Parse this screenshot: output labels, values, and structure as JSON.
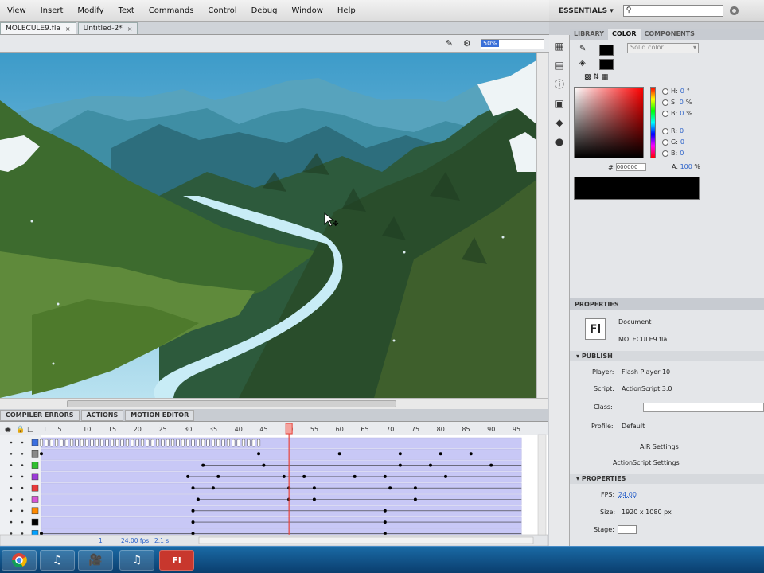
{
  "menu": [
    "View",
    "Insert",
    "Modify",
    "Text",
    "Commands",
    "Control",
    "Debug",
    "Window",
    "Help"
  ],
  "workspace": {
    "label": "ESSENTIALS",
    "search_icon": "search-icon"
  },
  "doc_tabs": [
    {
      "label": "MOLECULE9.fla",
      "close": "×"
    },
    {
      "label": "Untitled-2*",
      "close": "×"
    }
  ],
  "zoom": "50%",
  "timeline_tabs": [
    "COMPILER ERRORS",
    "ACTIONS",
    "MOTION EDITOR"
  ],
  "timeline": {
    "frame_numbers": [
      "1",
      "5",
      "10",
      "15",
      "20",
      "25",
      "30",
      "35",
      "40",
      "45",
      "50",
      "55",
      "60",
      "65",
      "70",
      "75",
      "80",
      "85",
      "90",
      "95"
    ],
    "playhead_frame": 50,
    "footer_fps": "24.00 fps",
    "footer_time": "2.1 s",
    "footer_frame": "1",
    "layer_colors": [
      "#3b6fe0",
      "#888888",
      "#2fbf2f",
      "#9b3ad8",
      "#e83a3a",
      "#d655d6",
      "#ff8a00",
      "#000000",
      "#00a0ff"
    ]
  },
  "color_panel": {
    "tabs": [
      "LIBRARY",
      "COLOR",
      "COMPONENTS"
    ],
    "active_tab": "COLOR",
    "type": "Solid color",
    "h": "0",
    "h_unit": "°",
    "s": "0",
    "s_unit": "%",
    "b": "0",
    "b_unit": "%",
    "r": "0",
    "g": "0",
    "bl": "0",
    "hex": "000000",
    "alpha": "100",
    "labels": {
      "h": "H:",
      "s": "S:",
      "b": "B:",
      "r": "R:",
      "g": "G:",
      "bl": "B:",
      "a": "A:",
      "hash": "#",
      "pct": "%"
    }
  },
  "properties": {
    "title": "PROPERTIES",
    "icon": "Fl",
    "doc_type": "Document",
    "doc_name": "MOLECULE9.fla",
    "publish_header": "PUBLISH",
    "player_label": "Player:",
    "player": "Flash Player 10",
    "script_label": "Script:",
    "script": "ActionScript 3.0",
    "class_label": "Class:",
    "profile_label": "Profile:",
    "profile": "Default",
    "air_settings": "AIR Settings",
    "as_settings": "ActionScript Settings",
    "props_header": "PROPERTIES",
    "fps_label": "FPS:",
    "fps": "24.00",
    "size_label": "Size:",
    "size": "1920 x 1080 px",
    "stage_label": "Stage:"
  },
  "taskbar": [
    "chrome-icon",
    "itunes-icon",
    "video-icon",
    "itunes-icon",
    "flash-icon"
  ],
  "colors": {
    "accent": "#2b62c9",
    "layer_bar": "#c8c8f6",
    "playhead": "#e8423a"
  }
}
